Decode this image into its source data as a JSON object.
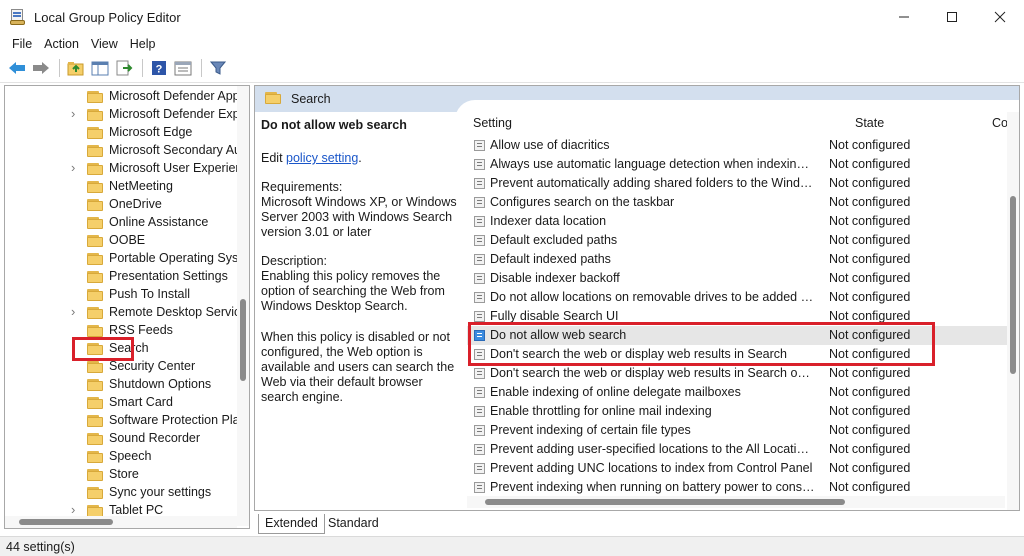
{
  "window": {
    "title": "Local Group Policy Editor",
    "controls": [
      "minimize-icon",
      "maximize-icon",
      "close-icon"
    ]
  },
  "menu": {
    "items": [
      "File",
      "Action",
      "View",
      "Help"
    ]
  },
  "toolbar": {
    "icons": [
      "back-arrow-icon",
      "forward-arrow-icon",
      "up-folder-icon",
      "show-hide-tree-icon",
      "export-list-icon",
      "help-icon",
      "properties-icon",
      "filter-icon"
    ]
  },
  "tree": {
    "items": [
      {
        "label": "Microsoft Defender Appl",
        "expandable": false
      },
      {
        "label": "Microsoft Defender Explo",
        "expandable": true
      },
      {
        "label": "Microsoft Edge",
        "expandable": false
      },
      {
        "label": "Microsoft Secondary Aut",
        "expandable": false
      },
      {
        "label": "Microsoft User Experienc",
        "expandable": true
      },
      {
        "label": "NetMeeting",
        "expandable": false
      },
      {
        "label": "OneDrive",
        "expandable": false
      },
      {
        "label": "Online Assistance",
        "expandable": false
      },
      {
        "label": "OOBE",
        "expandable": false
      },
      {
        "label": "Portable Operating Syste",
        "expandable": false
      },
      {
        "label": "Presentation Settings",
        "expandable": false
      },
      {
        "label": "Push To Install",
        "expandable": false
      },
      {
        "label": "Remote Desktop Services",
        "expandable": true
      },
      {
        "label": "RSS Feeds",
        "expandable": false
      },
      {
        "label": "Search",
        "expandable": false,
        "selected": true
      },
      {
        "label": "Security Center",
        "expandable": false
      },
      {
        "label": "Shutdown Options",
        "expandable": false
      },
      {
        "label": "Smart Card",
        "expandable": false
      },
      {
        "label": "Software Protection Platf",
        "expandable": false
      },
      {
        "label": "Sound Recorder",
        "expandable": false
      },
      {
        "label": "Speech",
        "expandable": false
      },
      {
        "label": "Store",
        "expandable": false
      },
      {
        "label": "Sync your settings",
        "expandable": false
      },
      {
        "label": "Tablet PC",
        "expandable": true
      }
    ]
  },
  "pane": {
    "header": "Search",
    "description": {
      "policy_name": "Do not allow web search",
      "edit_prefix": "Edit ",
      "edit_link": "policy setting",
      "edit_suffix": ".",
      "requirements_label": "Requirements:",
      "requirements_text": "Microsoft Windows XP, or Windows Server 2003 with Windows Search version 3.01 or later",
      "description_label": "Description:",
      "description_text": "Enabling this policy removes the option of searching the Web from Windows Desktop Search.",
      "description_text2": "When this policy is disabled or not configured, the Web option is available and users can search the Web via their default browser search engine."
    },
    "columns": {
      "setting": "Setting",
      "state": "State",
      "comment": "Co"
    },
    "settings": [
      {
        "name": "Allow use of diacritics",
        "state": "Not configured"
      },
      {
        "name": "Always use automatic language detection when indexing con...",
        "state": "Not configured"
      },
      {
        "name": "Prevent automatically adding shared folders to the Windows ...",
        "state": "Not configured"
      },
      {
        "name": "Configures search on the taskbar",
        "state": "Not configured"
      },
      {
        "name": "Indexer data location",
        "state": "Not configured"
      },
      {
        "name": "Default excluded paths",
        "state": "Not configured"
      },
      {
        "name": "Default indexed paths",
        "state": "Not configured"
      },
      {
        "name": "Disable indexer backoff",
        "state": "Not configured"
      },
      {
        "name": "Do not allow locations on removable drives to be added to li...",
        "state": "Not configured"
      },
      {
        "name": "Fully disable Search UI",
        "state": "Not configured"
      },
      {
        "name": "Do not allow web search",
        "state": "Not configured",
        "selected": true
      },
      {
        "name": "Don't search the web or display web results in Search",
        "state": "Not configured"
      },
      {
        "name": "Don't search the web or display web results in Search over m...",
        "state": "Not configured"
      },
      {
        "name": "Enable indexing of online delegate mailboxes",
        "state": "Not configured"
      },
      {
        "name": "Enable throttling for online mail indexing",
        "state": "Not configured"
      },
      {
        "name": "Prevent indexing of certain file types",
        "state": "Not configured"
      },
      {
        "name": "Prevent adding user-specified locations to the All Locations ...",
        "state": "Not configured"
      },
      {
        "name": "Prevent adding UNC locations to index from Control Panel",
        "state": "Not configured"
      },
      {
        "name": "Prevent indexing when running on battery power to conserve...",
        "state": "Not configured"
      }
    ]
  },
  "tabs": [
    "Extended",
    "Standard"
  ],
  "status": "44 setting(s)",
  "colors": {
    "highlight": "#d9202a",
    "header_bg": "#d3dfee",
    "link": "#1a56c9"
  }
}
